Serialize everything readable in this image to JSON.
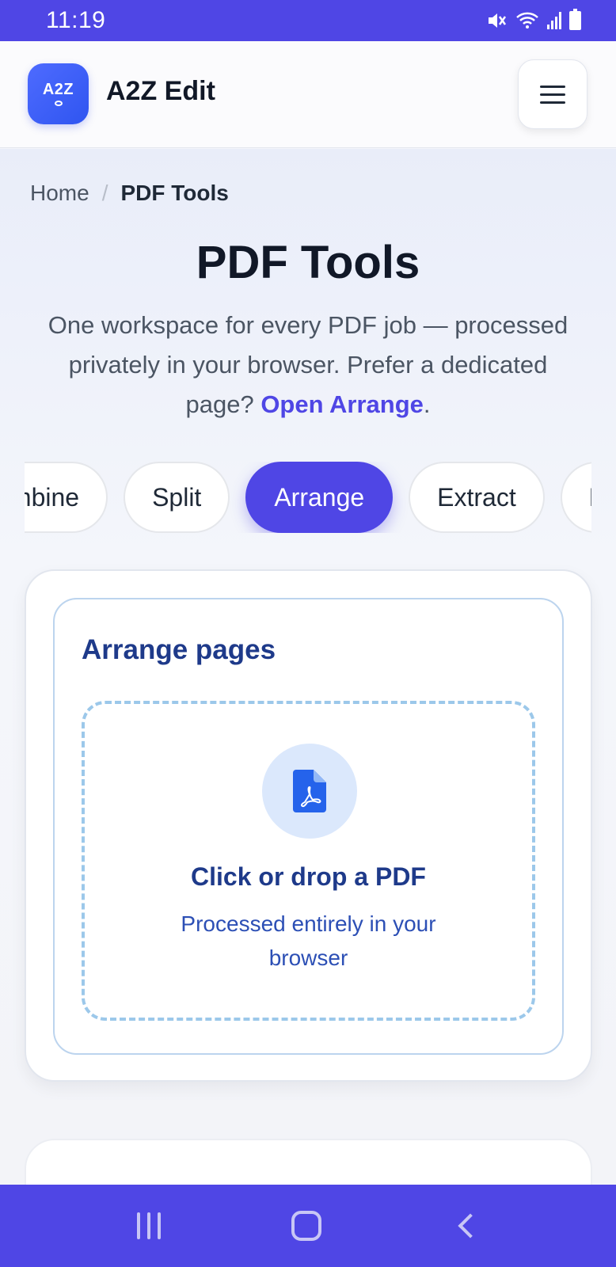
{
  "status_bar": {
    "time": "11:19",
    "icons": [
      "mute-icon",
      "wifi-icon",
      "signal-icon",
      "battery-icon"
    ]
  },
  "header": {
    "logo_text": "A2Z",
    "app_name": "A2Z Edit",
    "menu_icon": "hamburger-icon"
  },
  "breadcrumb": {
    "home": "Home",
    "separator": "/",
    "current": "PDF Tools"
  },
  "page": {
    "title": "PDF Tools",
    "description_prefix": "One workspace for every PDF job — processed privately in your browser. Prefer a dedicated page? ",
    "description_link": "Open Arrange",
    "description_suffix": "."
  },
  "tool_tabs": {
    "items": [
      {
        "label": "Combine",
        "active": false
      },
      {
        "label": "Split",
        "active": false
      },
      {
        "label": "Arrange",
        "active": true
      },
      {
        "label": "Extract",
        "active": false
      },
      {
        "label": "Rotate",
        "active": false
      }
    ]
  },
  "arrange_card": {
    "title": "Arrange pages",
    "dropzone": {
      "icon": "pdf-file-icon",
      "title": "Click or drop a PDF",
      "subtitle": "Processed entirely in your browser"
    }
  },
  "nav_bar": {
    "icons": [
      "recent-apps-icon",
      "home-icon",
      "back-icon"
    ]
  },
  "colors": {
    "brand": "#4f46e5",
    "title_blue": "#1e3a8a",
    "dropzone_border": "#9cc8ea",
    "icon_blue": "#2563eb"
  }
}
